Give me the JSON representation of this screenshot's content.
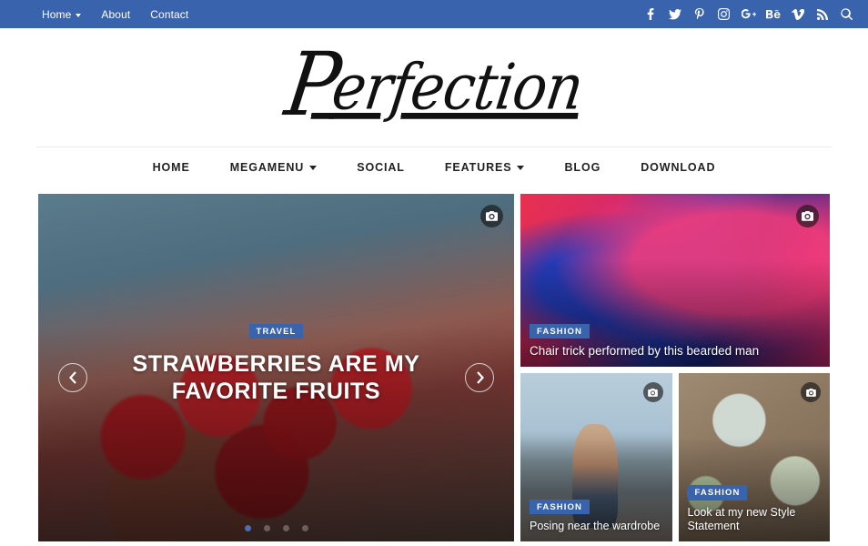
{
  "topbar": {
    "background": "#3a63ae",
    "links": [
      {
        "label": "Home",
        "has_caret": true
      },
      {
        "label": "About",
        "has_caret": false
      },
      {
        "label": "Contact",
        "has_caret": false
      }
    ],
    "socials": [
      {
        "name": "facebook-icon"
      },
      {
        "name": "twitter-icon"
      },
      {
        "name": "pinterest-icon"
      },
      {
        "name": "instagram-icon"
      },
      {
        "name": "google-plus-icon"
      },
      {
        "name": "behance-icon"
      },
      {
        "name": "vimeo-icon"
      },
      {
        "name": "rss-icon"
      },
      {
        "name": "search-icon"
      }
    ]
  },
  "brand": {
    "name": "Perfection",
    "initial": "P",
    "rest": "erfection"
  },
  "mainnav": {
    "items": [
      {
        "label": "HOME",
        "has_caret": false
      },
      {
        "label": "MEGAMENU",
        "has_caret": true
      },
      {
        "label": "SOCIAL",
        "has_caret": false
      },
      {
        "label": "FEATURES",
        "has_caret": true
      },
      {
        "label": "BLOG",
        "has_caret": false
      },
      {
        "label": "DOWNLOAD",
        "has_caret": false
      }
    ]
  },
  "featured": {
    "accent": "#3a63ae",
    "slider": {
      "category": "TRAVEL",
      "title": "STRAWBERRIES ARE MY FAVORITE FRUITS",
      "prev_label": "‹",
      "next_label": "›",
      "dots": [
        {
          "active": true
        },
        {
          "active": false
        },
        {
          "active": false
        },
        {
          "active": false
        }
      ]
    },
    "cards": [
      {
        "id": "bearded-man",
        "category": "FASHION",
        "title": "Chair trick performed by this bearded man"
      },
      {
        "id": "wardrobe",
        "category": "FASHION",
        "title": "Posing near the wardrobe"
      },
      {
        "id": "style-statement",
        "category": "FASHION",
        "title": "Look at my new Style Statement"
      }
    ]
  }
}
